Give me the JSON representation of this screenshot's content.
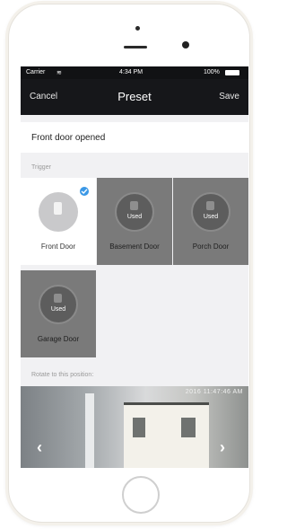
{
  "status_bar": {
    "carrier": "Carrier",
    "time": "4:34 PM",
    "battery": "100%"
  },
  "nav": {
    "cancel_label": "Cancel",
    "title": "Preset",
    "save_label": "Save"
  },
  "preset_name": "Front door opened",
  "trigger": {
    "section_label": "Trigger",
    "items": [
      {
        "label": "Front Door",
        "state": "selected",
        "badge": ""
      },
      {
        "label": "Basement Door",
        "state": "used",
        "badge": "Used"
      },
      {
        "label": "Porch Door",
        "state": "used",
        "badge": "Used"
      },
      {
        "label": "Garage Door",
        "state": "used",
        "badge": "Used"
      }
    ]
  },
  "position": {
    "section_label": "Rotate to this position:",
    "timestamp": "2016 11:47:46 AM"
  },
  "colors": {
    "accent": "#3b98e6",
    "nav_bg": "#16171a",
    "used_tile": "#7a7a7a"
  }
}
